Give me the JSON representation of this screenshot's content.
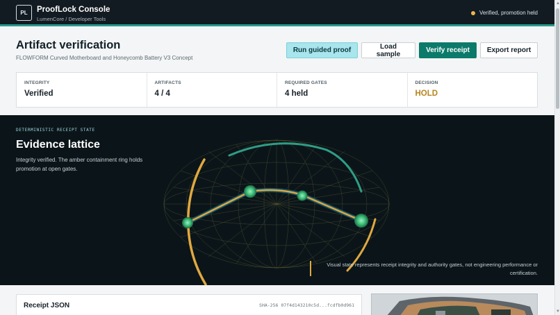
{
  "app": {
    "logo": "PL",
    "title": "ProofLock Console",
    "subtitle": "LumenCore / Developer Tools",
    "status": "Verified, promotion held",
    "status_color": "#f0b64a"
  },
  "header": {
    "title": "Artifact verification",
    "subtitle": "FLOWFORM Curved Motherboard and Honeycomb Battery V3 Concept"
  },
  "actions": {
    "guided": "Run guided proof",
    "load": "Load sample",
    "verify": "Verify receipt",
    "export": "Export report"
  },
  "stats": [
    {
      "label": "INTEGRITY",
      "value": "Verified"
    },
    {
      "label": "ARTIFACTS",
      "value": "4 / 4"
    },
    {
      "label": "REQUIRED GATES",
      "value": "4 held"
    },
    {
      "label": "DECISION",
      "value": "HOLD"
    }
  ],
  "hero": {
    "eyebrow": "DETERMINISTIC RECEIPT STATE",
    "title": "Evidence lattice",
    "description": "Integrity verified. The amber containment ring holds promotion at open gates.",
    "note": "Visual state represents receipt integrity and authority gates, not engineering performance or certification."
  },
  "receipt": {
    "title": "Receipt JSON",
    "hash": "SHA-256 07f4d143210c5d...fcdfb0d961"
  },
  "colors": {
    "accent": "#0c7a6a",
    "hold": "#b8841d",
    "ring_amber": "#e0a840",
    "ring_teal": "#2f9d86",
    "node_green": "#3fbf7a"
  }
}
